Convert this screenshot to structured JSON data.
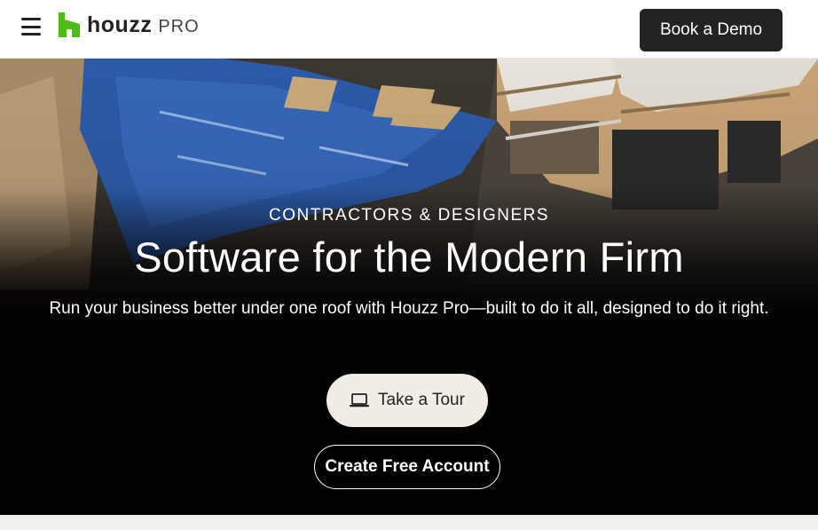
{
  "header": {
    "logo_text": "houzz",
    "logo_suffix": "PRO",
    "demo_button_label": "Book a Demo",
    "logo_color": "#4dbc15",
    "icons": {
      "menu": "hamburger-menu-icon",
      "logo": "houzz-logo-icon"
    }
  },
  "hero": {
    "eyebrow": "CONTRACTORS & DESIGNERS",
    "headline": "Software for the Modern Firm",
    "subhead": "Run your business better under one roof with Houzz Pro—built to do it all, designed to do it right.",
    "tour_button_label": "Take a Tour",
    "tour_icon": "laptop-icon",
    "account_button_label": "Create Free Account"
  },
  "colors": {
    "button_dark": "#222222",
    "tour_button_bg": "#f1ede6",
    "hero_bg": "#000000",
    "page_bg": "#f3f1ec"
  }
}
